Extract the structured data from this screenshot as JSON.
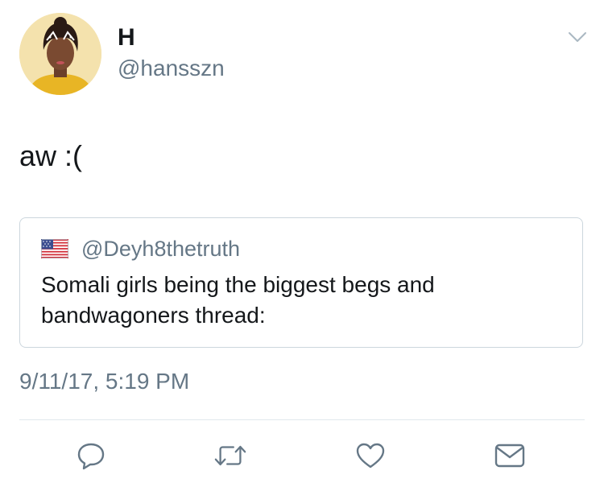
{
  "tweet": {
    "author": {
      "display_name": "H",
      "handle": "@hansszn"
    },
    "text": "aw :(",
    "timestamp": "9/11/17, 5:19 PM",
    "menu_icon": "chevron-down-icon"
  },
  "quoted_tweet": {
    "flag_icon": "us-flag-icon",
    "handle": "@Deyh8thetruth",
    "text": "Somali girls being the biggest begs and bandwagoners thread:"
  },
  "actions": [
    {
      "icon": "reply-icon"
    },
    {
      "icon": "retweet-icon"
    },
    {
      "icon": "like-icon"
    },
    {
      "icon": "direct-message-icon"
    }
  ],
  "colors": {
    "primary_text": "#14171a",
    "secondary_text": "#657786",
    "border": "#ccd6dd",
    "divider": "#e1e8ed",
    "avatar_background": "#f3dfa5",
    "avatar_shirt": "#e8b525"
  }
}
